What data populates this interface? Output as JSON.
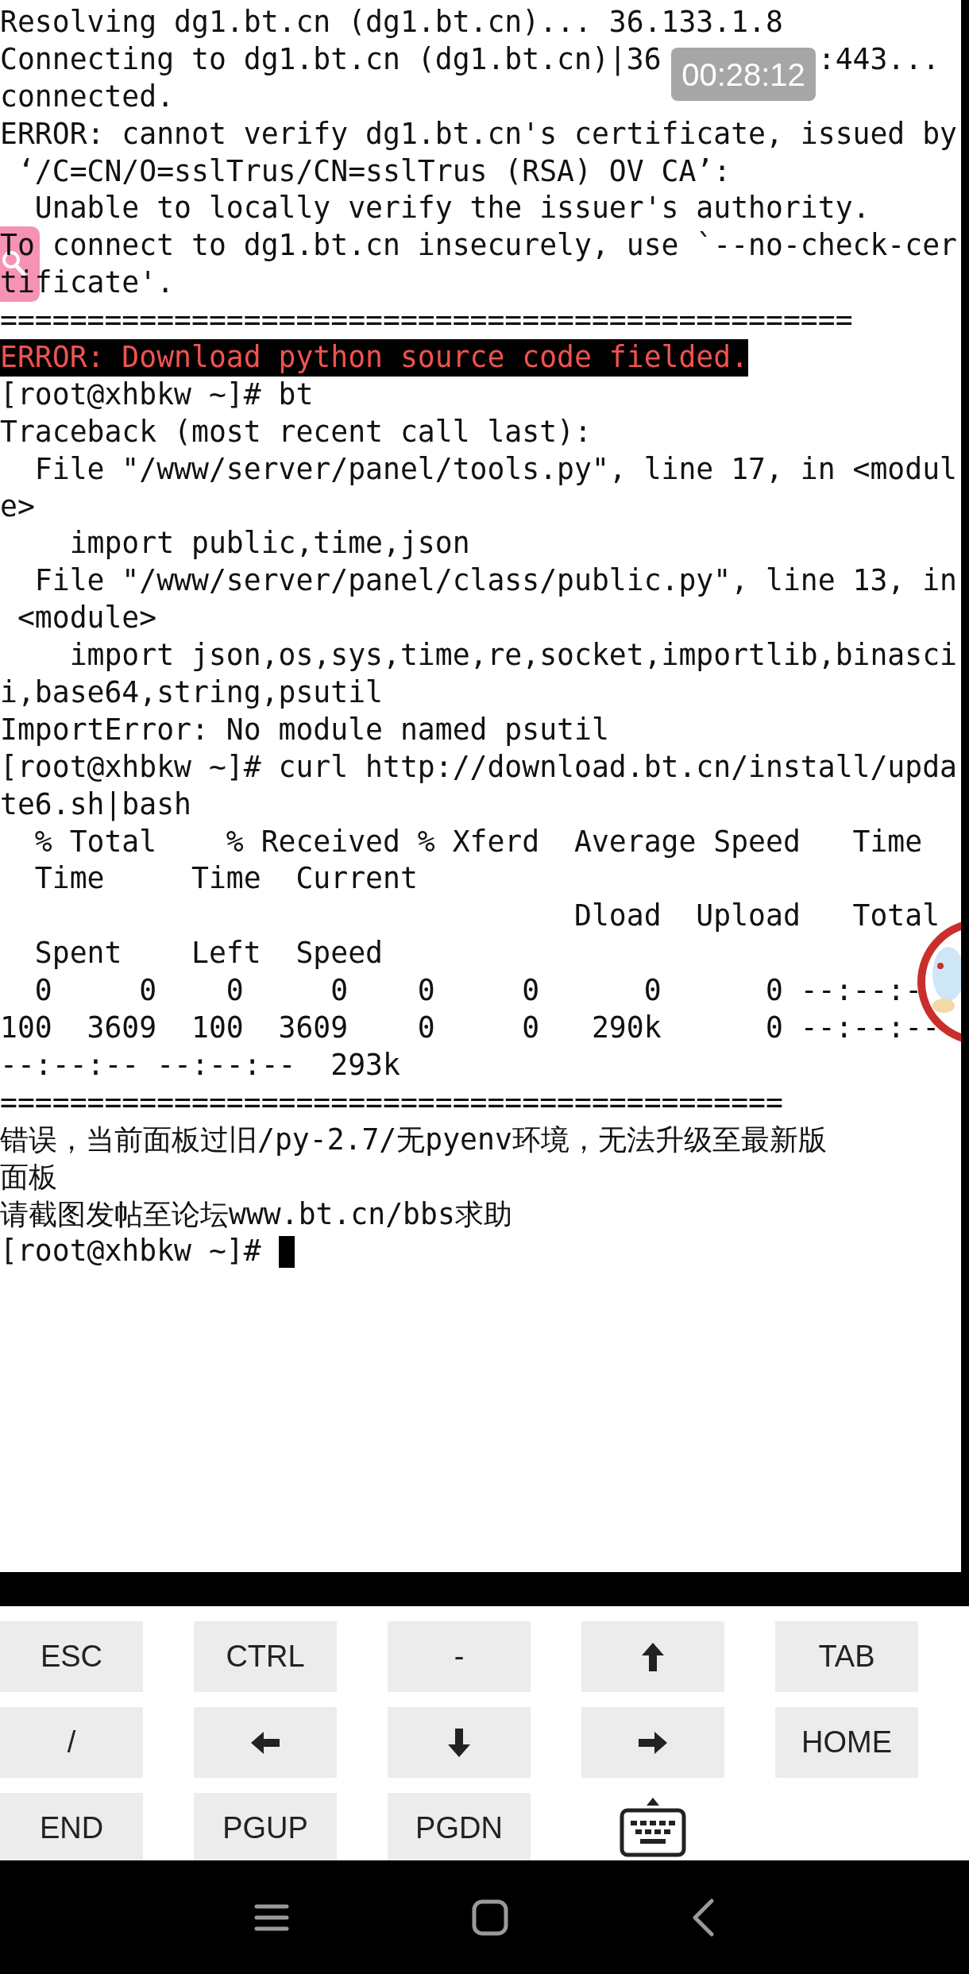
{
  "terminal": {
    "lines": [
      {
        "kind": "output",
        "text": "Resolving dg1.bt.cn (dg1.bt.cn)... 36.133.1.8"
      },
      {
        "kind": "covered",
        "parts": [
          "Connecting to dg1.bt.cn (dg1.bt.cn)|36",
          ":443..."
        ]
      },
      {
        "kind": "output",
        "text": "connected."
      },
      {
        "kind": "output",
        "text": "ERROR: cannot verify dg1.bt.cn's certificate, issued by"
      },
      {
        "kind": "output",
        "text": " ‘/C=CN/O=sslTrus/CN=sslTrus (RSA) OV CA’:"
      },
      {
        "kind": "output",
        "text": "  Unable to locally verify the issuer's authority."
      },
      {
        "kind": "split",
        "parts": [
          "To",
          " connect to dg1.bt.cn insecurely, use `--no-check-cer"
        ]
      },
      {
        "kind": "split",
        "parts": [
          "ti",
          "ficate'."
        ]
      },
      {
        "kind": "output",
        "text": "================================================="
      },
      {
        "kind": "error",
        "text": "ERROR: Download python source code fielded."
      },
      {
        "kind": "output",
        "text": "[root@xhbkw ~]# bt"
      },
      {
        "kind": "output",
        "text": "Traceback (most recent call last):"
      },
      {
        "kind": "output",
        "text": "  File \"/www/server/panel/tools.py\", line 17, in <modul"
      },
      {
        "kind": "output",
        "text": "e>"
      },
      {
        "kind": "output",
        "text": "    import public,time,json"
      },
      {
        "kind": "output",
        "text": "  File \"/www/server/panel/class/public.py\", line 13, in"
      },
      {
        "kind": "output",
        "text": " <module>"
      },
      {
        "kind": "output",
        "text": "    import json,os,sys,time,re,socket,importlib,binasci"
      },
      {
        "kind": "output",
        "text": "i,base64,string,psutil"
      },
      {
        "kind": "output",
        "text": "ImportError: No module named psutil"
      },
      {
        "kind": "output",
        "text": "[root@xhbkw ~]# curl http://download.bt.cn/install/upda"
      },
      {
        "kind": "output",
        "text": "te6.sh|bash"
      },
      {
        "kind": "output",
        "text": "  % Total    % Received % Xferd  Average Speed   Time"
      },
      {
        "kind": "output",
        "text": "  Time     Time  Current"
      },
      {
        "kind": "output",
        "text": "                                 Dload  Upload   Total"
      },
      {
        "kind": "output",
        "text": "  Spent    Left  Speed"
      },
      {
        "kind": "output",
        "text": "  0     0    0     0    0     0      0      0 --:--:-"
      },
      {
        "kind": "output",
        "text": "100  3609  100  3609    0     0   290k      0 --:--:--"
      },
      {
        "kind": "output",
        "text": "--:--:-- --:--:--  293k"
      },
      {
        "kind": "output",
        "text": "============================================="
      },
      {
        "kind": "output",
        "text": "错误，当前面板过旧/py-2.7/无pyenv环境，无法升级至最新版"
      },
      {
        "kind": "output",
        "text": "面板"
      },
      {
        "kind": "output",
        "text": "请截图发帖至论坛www.bt.cn/bbs求助"
      },
      {
        "kind": "prompt",
        "text": "[root@xhbkw ~]# ",
        "cursor": true
      }
    ]
  },
  "timer": "00:28:12",
  "keys": [
    {
      "kind": "text",
      "label": "ESC"
    },
    {
      "kind": "text",
      "label": "CTRL"
    },
    {
      "kind": "text",
      "label": "-"
    },
    {
      "kind": "up"
    },
    {
      "kind": "text",
      "label": "TAB"
    },
    {
      "kind": "text",
      "label": "/"
    },
    {
      "kind": "left"
    },
    {
      "kind": "down"
    },
    {
      "kind": "right"
    },
    {
      "kind": "text",
      "label": "HOME"
    },
    {
      "kind": "text",
      "label": "END"
    },
    {
      "kind": "text",
      "label": "PGUP"
    },
    {
      "kind": "text",
      "label": "PGDN"
    },
    {
      "kind": "keyboard"
    }
  ]
}
